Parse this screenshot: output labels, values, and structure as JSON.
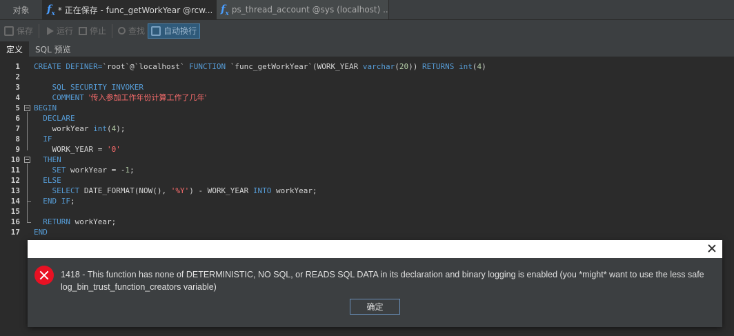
{
  "tabs": [
    {
      "label": "对象",
      "icon": ""
    },
    {
      "label": "* 正在保存 - func_getWorkYear @rcw...",
      "icon": "function-icon"
    },
    {
      "label": "ps_thread_account @sys (localhost) ...",
      "icon": "function-icon"
    }
  ],
  "toolbar": {
    "save_label": "保存",
    "run_label": "运行",
    "stop_label": "停止",
    "find_label": "查找",
    "wrap_label": "自动换行"
  },
  "subtabs": [
    "定义",
    "SQL 预览"
  ],
  "line_numbers": [
    "1",
    "2",
    "3",
    "4",
    "5",
    "6",
    "7",
    "8",
    "9",
    "10",
    "11",
    "12",
    "13",
    "14",
    "15",
    "16",
    "17"
  ],
  "code": {
    "l1_a": "CREATE DEFINER=",
    "l1_b": "`root`@`localhost`",
    "l1_c": " FUNCTION ",
    "l1_d": "`func_getWorkYear`(WORK_YEAR ",
    "l1_e": "varchar",
    "l1_f": "(",
    "l1_g": "20",
    "l1_h": ")) ",
    "l1_i": "RETURNS ",
    "l1_j": "int",
    "l1_k": "(",
    "l1_l": "4",
    "l1_m": ")",
    "l3": "    SQL SECURITY INVOKER",
    "l4_a": "    COMMENT ",
    "l4_b": "'传入参加工作年份计算工作了几年'",
    "l5": "BEGIN",
    "l6": "  DECLARE",
    "l7_a": "    workYear ",
    "l7_b": "int",
    "l7_c": "(",
    "l7_d": "4",
    "l7_e": ");",
    "l8": "  IF",
    "l9_a": "    WORK_YEAR = ",
    "l9_b": "'0'",
    "l10": "  THEN",
    "l11_a": "    SET ",
    "l11_b": "workYear = -",
    "l11_c": "1",
    "l11_d": ";",
    "l12": "  ELSE",
    "l13_a": "    SELECT ",
    "l13_b": "DATE_FORMAT(NOW(), ",
    "l13_c": "'%Y'",
    "l13_d": ") - WORK_YEAR ",
    "l13_e": "INTO ",
    "l13_f": "workYear;",
    "l14_a": "  END IF",
    "l14_b": ";",
    "l16_a": "  RETURN ",
    "l16_b": "workYear;",
    "l17": "END"
  },
  "dialog": {
    "message": "1418 - This function has none of DETERMINISTIC, NO SQL, or READS SQL DATA in its declaration and binary logging is enabled (you *might* want to use the less safe log_bin_trust_function_creators variable)",
    "ok_label": "确定"
  },
  "colors": {
    "error": "#e81123",
    "keyword": "#569cd6",
    "string": "#ff6e6e",
    "number": "#b5cea8"
  }
}
